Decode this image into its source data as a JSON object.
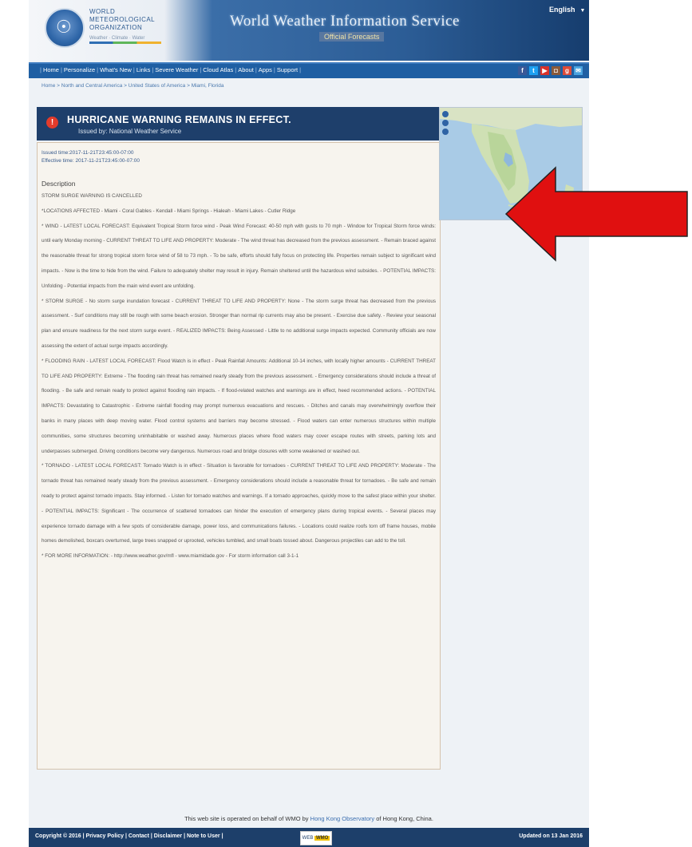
{
  "header": {
    "org_name_lines": [
      "WORLD",
      "METEOROLOGICAL",
      "ORGANIZATION"
    ],
    "org_tagline": "Weather · Climate · Water",
    "site_title": "World Weather Information Service",
    "site_subtitle": "Official Forecasts",
    "language": "English"
  },
  "nav": {
    "items": [
      "Home",
      "Personalize",
      "What's New",
      "Links",
      "Severe Weather",
      "Cloud Atlas",
      "About",
      "Apps",
      "Support"
    ],
    "social_icons": [
      "facebook-icon",
      "twitter-icon",
      "youtube-icon",
      "instagram-icon",
      "googleplus-icon",
      "share-icon"
    ]
  },
  "breadcrumb": "Home > North and Central America > United States of America > Miami, Florida",
  "warning": {
    "title": "HURRICANE WARNING REMAINS IN EFFECT.",
    "issued_by": "Issued by: National Weather Service",
    "issued_time": "Issued time:2017-11-21T23:45:00-07:00",
    "effective_time": "Effective time: 2017-11-21T23:45:00-07:00",
    "description_label": "Description",
    "paragraphs": [
      "STORM SURGE WARNING IS CANCELLED",
      "*LOCATIONS AFFECTED - Miami - Coral Gables - Kendall - Miami Springs - Hialeah - Miami Lakes - Cutler Ridge",
      "* WIND - LATEST LOCAL FORECAST: Equivalent Tropical Storm force wind - Peak Wind Forecast: 40-50 mph with gusts to 70 mph - Window for Tropical Storm force winds: until early Monday morning - CURRENT THREAT TO LIFE AND PROPERTY: Moderate - The wind threat has decreased from the previous assessment. - Remain braced against the reasonable threat for strong tropical storm force wind of 58 to 73 mph. - To be safe, efforts should fully focus on protecting life. Properties remain subject to significant wind impacts. - Now is the time to hide from the wind. Failure to adequately shelter may result in injury. Remain sheltered until the hazardous wind subsides. - POTENTIAL IMPACTS: Unfolding - Potential impacts from the main wind event are unfolding.",
      "* STORM SURGE - No storm surge inundation forecast - CURRENT THREAT TO LIFE AND PROPERTY: None - The storm surge threat has decreased from the previous assessment. - Surf conditions may still be rough with some beach erosion. Stronger than normal rip currents may also be present. - Exercise due safety. - Review your seasonal plan and ensure readiness for the next storm surge event. - REALIZED IMPACTS: Being Assessed - Little to no additional surge impacts expected. Community officials are now assessing the extent of actual surge impacts accordingly.",
      "* FLOODING RAIN - LATEST LOCAL FORECAST: Flood Watch is in effect - Peak Rainfall Amounts: Additional 10-14 inches, with locally higher amounts - CURRENT THREAT TO LIFE AND PROPERTY: Extreme - The flooding rain threat has remained nearly steady from the previous assessment. - Emergency considerations should include a threat of flooding. - Be safe and remain ready to protect against flooding rain impacts. - If flood-related watches and warnings are in effect, heed recommended actions. - POTENTIAL IMPACTS: Devastating to Catastrophic - Extreme rainfall flooding may prompt numerous evacuations and rescues. - Ditches and canals may overwhelmingly overflow their banks in many places with deep moving water. Flood control systems and barriers may become stressed. - Flood waters can enter numerous structures within multiple communities, some structures becoming uninhabitable or washed away. Numerous places where flood waters may cover escape routes with streets, parking lots and underpasses submerged. Driving conditions become very dangerous. Numerous road and bridge closures with some weakened or washed out.",
      "* TORNADO - LATEST LOCAL FORECAST: Tornado Watch is in effect - Situation is favorable for tornadoes - CURRENT THREAT TO LIFE AND PROPERTY: Moderate - The tornado threat has remained nearly steady from the previous assessment. - Emergency considerations should include a reasonable threat for tornadoes. - Be safe and remain ready to protect against tornado impacts. Stay informed. - Listen for tornado watches and warnings. If a tornado approaches, quickly move to the safest place within your shelter. - POTENTIAL IMPACTS: Significant - The occurrence of scattered tornadoes can hinder the execution of emergency plans during tropical events. - Several places may experience tornado damage with a few spots of considerable damage, power loss, and communications failures. - Locations could realize roofs torn off frame houses, mobile homes demolished, boxcars overturned, large trees snapped or uprooted, vehicles tumbled, and small boats tossed about. Dangerous projectiles can add to the toll.",
      "* FOR MORE INFORMATION: - http://www.weather.gov/mfl - www.miamidade.gov - For storm information call 3-1-1"
    ]
  },
  "footer": {
    "operated_prefix": "This web site is operated on behalf of WMO by",
    "operated_link": "Hong Kong Observatory",
    "operated_suffix": "of Hong Kong, China.",
    "links": "Copyright © 2016 | Privacy Policy | Contact | Disclaimer | Note to User |",
    "badge_text": "WEB",
    "badge_highlight": "WMO",
    "updated": "Updated on 13 Jan 2016"
  },
  "colors": {
    "nav": "#1f5fa3",
    "warning_header": "#1e3f6b",
    "warning_icon": "#e23b2b",
    "annotation_arrow": "#e01010"
  }
}
